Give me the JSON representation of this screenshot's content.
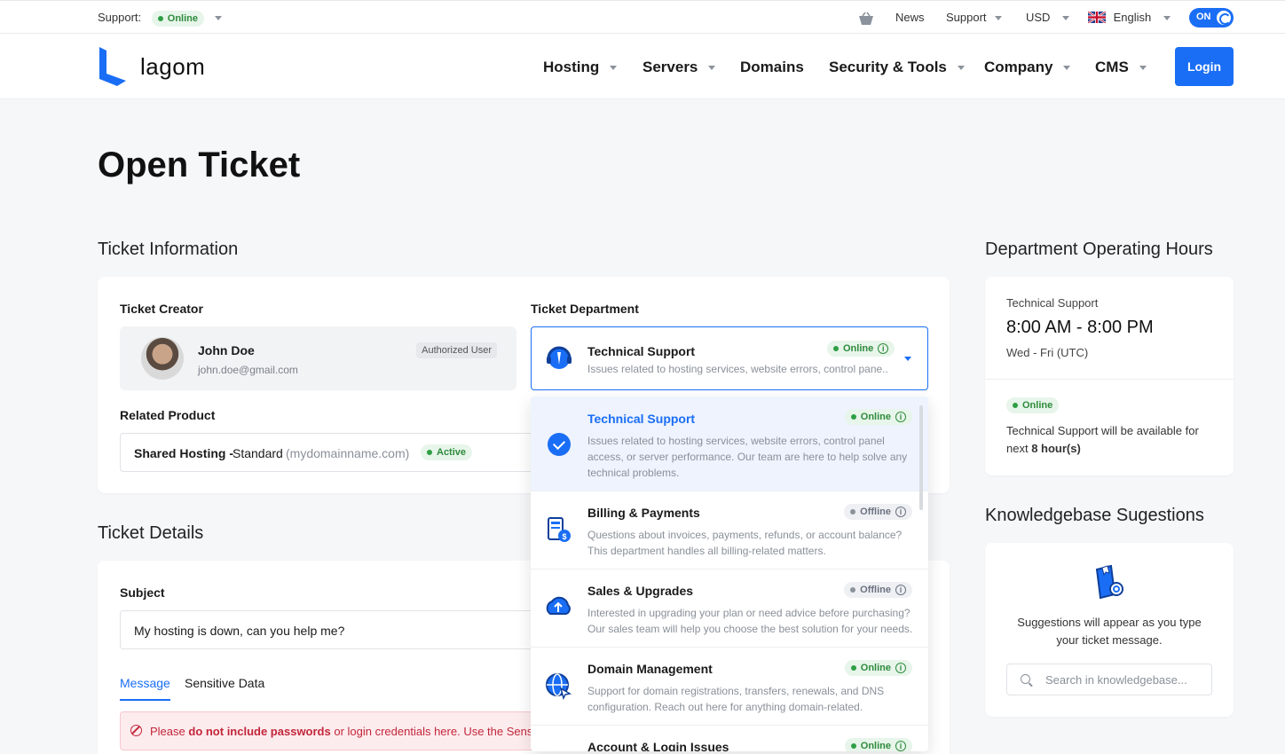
{
  "topbar": {
    "support_label": "Support:",
    "support_status": "Online",
    "links": [
      "News",
      "Support",
      "USD",
      "English"
    ],
    "toggle_label": "ON"
  },
  "header": {
    "logo_text": "lagom",
    "nav": [
      "Hosting",
      "Servers",
      "Domains",
      "Security & Tools",
      "Company",
      "CMS"
    ],
    "login": "Login"
  },
  "page": {
    "title": "Open Ticket"
  },
  "ticket_info": {
    "section_title": "Ticket Information",
    "creator_label": "Ticket Creator",
    "creator_name": "John Doe",
    "creator_email": "john.doe@gmail.com",
    "creator_badge": "Authorized User",
    "department_label": "Ticket Department",
    "selected_department": {
      "title": "Technical Support",
      "status": "Online",
      "desc": "Issues related to hosting services, website errors, control pane..."
    },
    "related_label": "Related Product",
    "product_name": "Shared Hosting -",
    "product_plan": "Standard",
    "product_domain": "(mydomainname.com)",
    "product_status": "Active"
  },
  "dropdown": {
    "options": [
      {
        "title": "Technical Support",
        "status": "Online",
        "desc": "Issues related to hosting services, website errors, control panel access, or server performance. Our team are here to help solve any technical problems."
      },
      {
        "title": "Billing & Payments",
        "status": "Offline",
        "desc": "Questions about invoices, payments, refunds, or account balance? This department handles all billing-related matters."
      },
      {
        "title": "Sales & Upgrades",
        "status": "Offline",
        "desc": "Interested in upgrading your plan or need advice before purchasing? Our sales team will help you choose the best solution for your needs."
      },
      {
        "title": "Domain Management",
        "status": "Online",
        "desc": "Support for domain registrations, transfers, renewals, and DNS configuration. Reach out here for anything domain-related."
      },
      {
        "title": "Account & Login Issues",
        "status": "Online",
        "desc": ""
      }
    ]
  },
  "ticket_details": {
    "section_title": "Ticket Details",
    "subject_label": "Subject",
    "subject_value": "My hosting is down, can you help me?",
    "tabs": [
      "Message",
      "Sensitive Data"
    ],
    "alert_pre": "Please ",
    "alert_bold": "do not include passwords",
    "alert_post": " or login credentials here. Use the Sensitiv"
  },
  "sidebar": {
    "hours_title": "Department Operating Hours",
    "hours_dept": "Technical Support",
    "hours_time": "8:00 AM - 8:00 PM",
    "hours_days": "Wed - Fri (UTC)",
    "status": "Online",
    "avail_pre": "Technical Support will be available for next ",
    "avail_bold": "8 hour(s)",
    "kb_title": "Knowledgebase Sugestions",
    "kb_text": "Suggestions will appear as you type your ticket message.",
    "kb_search_placeholder": "Search in knowledgebase..."
  },
  "colors": {
    "accent": "#1a6ef5",
    "online": "#2e9f44",
    "offline": "#8b929b",
    "danger": "#c3263a"
  },
  "icons": [
    "basket-icon",
    "uk-flag-icon",
    "moon-icon",
    "support-icon",
    "billing-icon",
    "sales-icon",
    "domain-icon",
    "check-icon",
    "info-icon",
    "search-icon",
    "knowledgebase-icon"
  ]
}
